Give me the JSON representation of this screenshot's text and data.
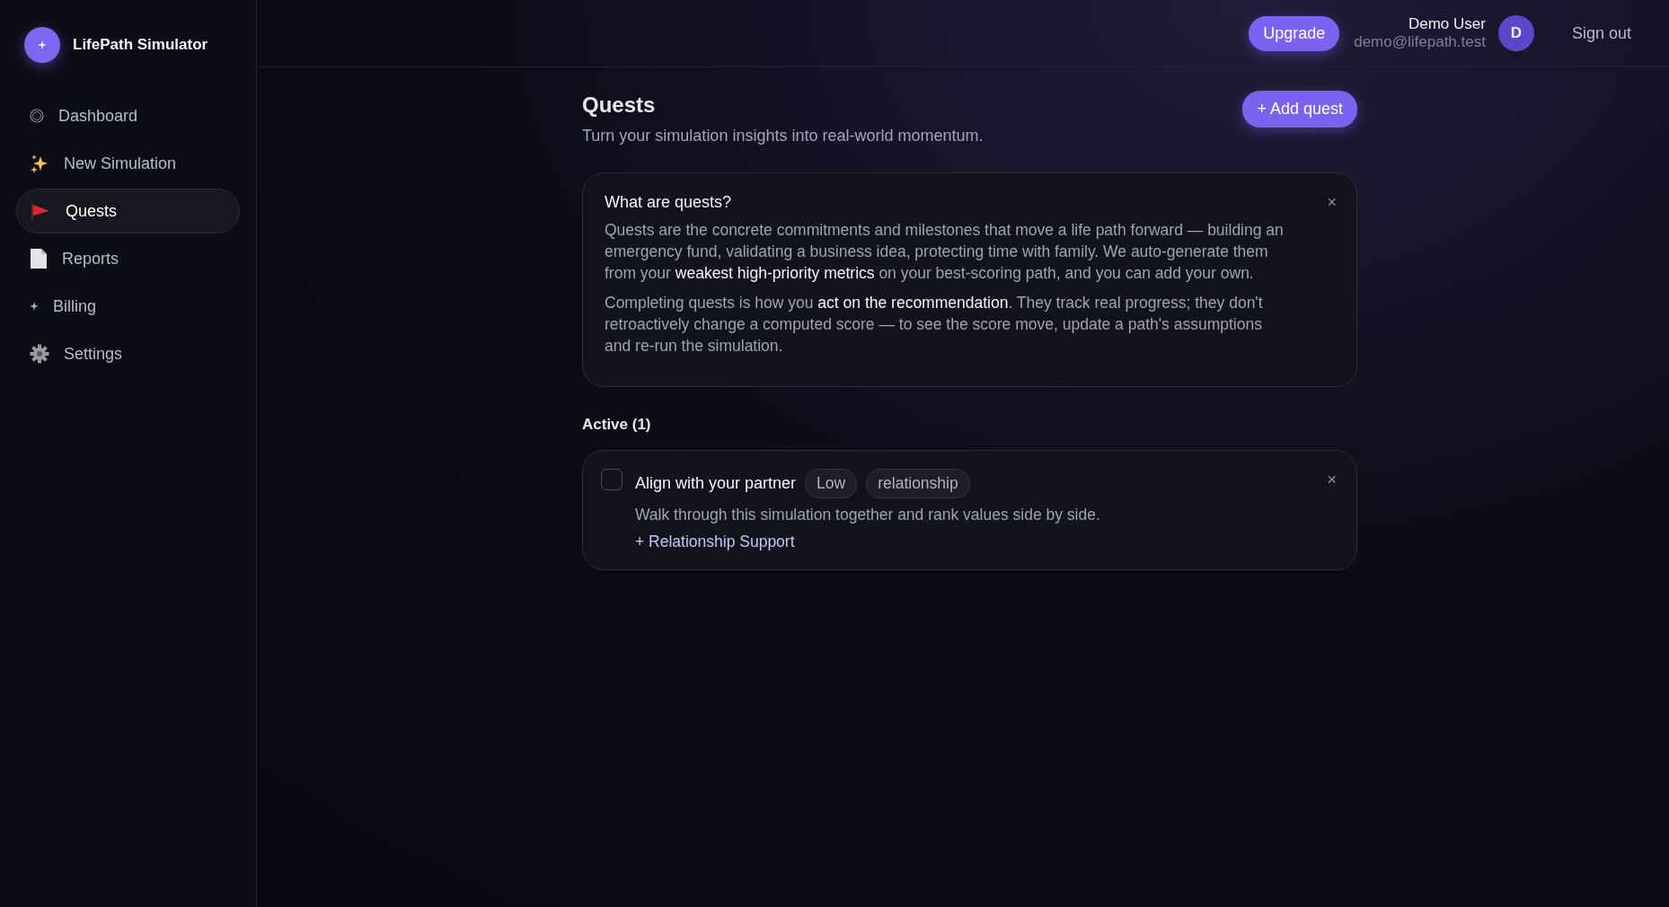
{
  "app": {
    "name": "LifePath Simulator"
  },
  "sidebar": {
    "items": [
      {
        "label": "Dashboard",
        "selected": false
      },
      {
        "label": "New Simulation",
        "selected": false
      },
      {
        "label": "Quests",
        "selected": true
      },
      {
        "label": "Reports",
        "selected": false
      },
      {
        "label": "Billing",
        "selected": false
      },
      {
        "label": "Settings",
        "selected": false
      }
    ]
  },
  "header": {
    "upgrade": "Upgrade",
    "user_name": "Demo User",
    "user_email": "demo@lifepath.test",
    "avatar": "D",
    "sign_out": "Sign out"
  },
  "page": {
    "title": "Quests",
    "subtitle": "Turn your simulation insights into real-world momentum.",
    "add_button": "+ Add quest"
  },
  "info": {
    "title": "What are quests?",
    "close": "×",
    "paragraphs": [
      "Quests are the concrete commitments and milestones that move a life path forward — building an emergency fund, validating a business idea, protecting time with family. We auto-generate them from your **weakest high-priority metrics** on your best-scoring path, and you can add your own.",
      "Completing quests is how you **act on the recommendation**. They track real progress; they don't retroactively change a computed score — to see the score move, update a path's assumptions and re-run the simulation."
    ]
  },
  "active": {
    "heading": "Active (1)",
    "quests": [
      {
        "title": "Align with your partner",
        "checked": false,
        "tags": [
          "Low",
          "relationship"
        ],
        "description": "Walk through this simulation together and rank values side by side.",
        "link": "+ Relationship Support",
        "close": "×"
      }
    ]
  }
}
